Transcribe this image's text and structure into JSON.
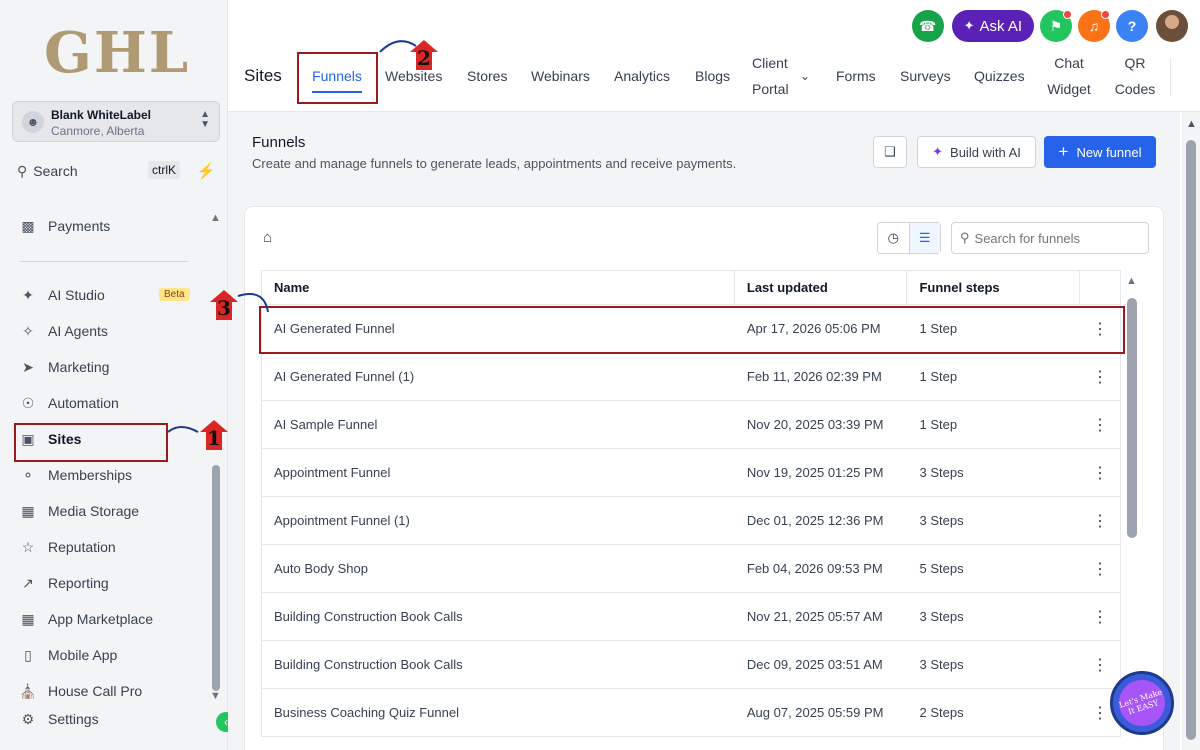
{
  "brand": {
    "logo": "GHL"
  },
  "account": {
    "name": "Blank WhiteLabel",
    "location": "Canmore, Alberta"
  },
  "sidebar": {
    "search_label": "Search",
    "search_shortcut": "ctrlK",
    "items": [
      {
        "label": "Payments",
        "icon": "payments-icon"
      },
      {
        "label": "AI Studio",
        "icon": "ai-studio-icon",
        "badge": "Beta"
      },
      {
        "label": "AI Agents",
        "icon": "ai-agents-icon"
      },
      {
        "label": "Marketing",
        "icon": "marketing-icon"
      },
      {
        "label": "Automation",
        "icon": "automation-icon"
      },
      {
        "label": "Sites",
        "icon": "sites-icon",
        "active": true
      },
      {
        "label": "Memberships",
        "icon": "memberships-icon"
      },
      {
        "label": "Media Storage",
        "icon": "media-storage-icon"
      },
      {
        "label": "Reputation",
        "icon": "reputation-icon"
      },
      {
        "label": "Reporting",
        "icon": "reporting-icon"
      },
      {
        "label": "App Marketplace",
        "icon": "app-marketplace-icon"
      },
      {
        "label": "Mobile App",
        "icon": "mobile-app-icon"
      },
      {
        "label": "House Call Pro",
        "icon": "house-call-pro-icon"
      },
      {
        "label": "Settings",
        "icon": "settings-icon"
      }
    ]
  },
  "topbar": {
    "ask_ai_label": "Ask AI",
    "help_label": "?",
    "colors": {
      "phone": "#16a34a",
      "ask_ai": "#5b21b6",
      "announce": "#22c55e",
      "bell": "#f97316",
      "help": "#3b82f6"
    }
  },
  "tabs": {
    "section": "Sites",
    "items": [
      {
        "label": "Funnels",
        "active": true
      },
      {
        "label": "Websites"
      },
      {
        "label": "Stores"
      },
      {
        "label": "Webinars"
      },
      {
        "label": "Analytics"
      },
      {
        "label": "Blogs"
      },
      {
        "label": "Client Portal"
      },
      {
        "label": "Forms"
      },
      {
        "label": "Surveys"
      },
      {
        "label": "Quizzes"
      },
      {
        "label": "Chat Widget"
      },
      {
        "label": "QR Codes"
      }
    ]
  },
  "page": {
    "title": "Funnels",
    "description": "Create and manage funnels to generate leads, appointments and receive payments.",
    "build_ai_label": "Build with AI",
    "new_funnel_label": "New funnel",
    "search_placeholder": "Search for funnels"
  },
  "table": {
    "headers": [
      "Name",
      "Last updated",
      "Funnel steps"
    ],
    "rows": [
      {
        "name": "AI Generated Funnel",
        "updated": "Apr 17, 2026 05:06 PM",
        "steps": "1 Step"
      },
      {
        "name": "AI Generated Funnel (1)",
        "updated": "Feb 11, 2026 02:39 PM",
        "steps": "1 Step"
      },
      {
        "name": "AI Sample Funnel",
        "updated": "Nov 20, 2025 03:39 PM",
        "steps": "1 Step"
      },
      {
        "name": "Appointment Funnel",
        "updated": "Nov 19, 2025 01:25 PM",
        "steps": "3 Steps"
      },
      {
        "name": "Appointment Funnel (1)",
        "updated": "Dec 01, 2025 12:36 PM",
        "steps": "3 Steps"
      },
      {
        "name": "Auto Body Shop",
        "updated": "Feb 04, 2026 09:53 PM",
        "steps": "5 Steps"
      },
      {
        "name": "Building Construction Book Calls",
        "updated": "Nov 21, 2025 05:57 AM",
        "steps": "3 Steps"
      },
      {
        "name": "Building Construction Book Calls",
        "updated": "Dec 09, 2025 03:51 AM",
        "steps": "3 Steps"
      },
      {
        "name": "Business Coaching Quiz Funnel",
        "updated": "Aug 07, 2025 05:59 PM",
        "steps": "2 Steps"
      }
    ]
  },
  "annotations": {
    "step1": "1",
    "step2": "2",
    "step3": "3"
  },
  "watermark": {
    "text": "Let's Make It EASY"
  }
}
